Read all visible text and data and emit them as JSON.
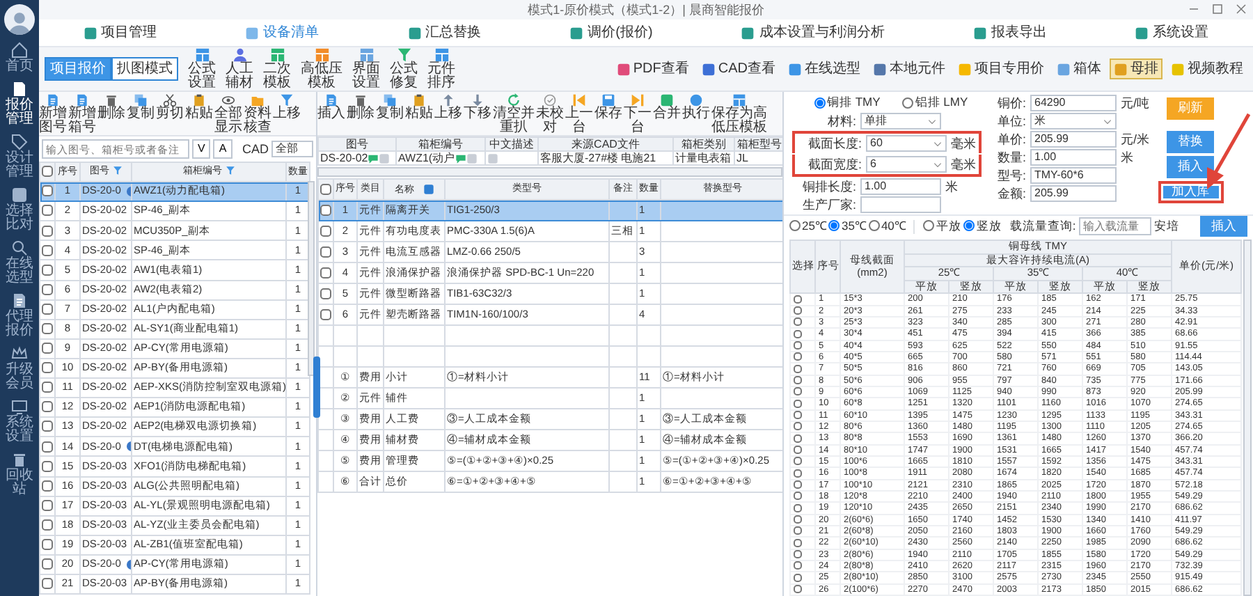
{
  "window": {
    "title": "模式1-原价模式（模式1-2）| 晨商智能报价"
  },
  "sidebar": {
    "items": [
      {
        "label": "首页",
        "selected": false
      },
      {
        "label": "报价管理",
        "selected": true
      },
      {
        "label": "设计管理",
        "selected": false
      },
      {
        "label": "选择比对",
        "selected": false
      },
      {
        "label": "在线选型",
        "selected": false
      },
      {
        "label": "代理报价",
        "selected": false
      },
      {
        "label": "升级会员",
        "selected": false
      },
      {
        "label": "系统设置",
        "selected": false
      },
      {
        "label": "回收站",
        "selected": false
      }
    ]
  },
  "menu": [
    {
      "label": "项目管理",
      "selected": false
    },
    {
      "label": "设备清单",
      "selected": true
    },
    {
      "label": "汇总替换",
      "selected": false
    },
    {
      "label": "调价(报价)",
      "selected": false
    },
    {
      "label": "成本设置与利润分析",
      "selected": false
    },
    {
      "label": "报表导出",
      "selected": false
    },
    {
      "label": "系统设置",
      "selected": false
    }
  ],
  "mode_buttons": [
    {
      "label": "项目报价",
      "selected": true
    },
    {
      "label": "扒图模式",
      "selected": false
    }
  ],
  "tools": [
    "公式设置",
    "人工辅材",
    "二次模板",
    "高低压模板",
    "界面设置",
    "公式修复",
    "元件排序"
  ],
  "right_tools": [
    {
      "label": "PDF查看",
      "selected": false
    },
    {
      "label": "CAD查看",
      "selected": false
    },
    {
      "label": "在线选型",
      "selected": false
    },
    {
      "label": "本地元件",
      "selected": false
    },
    {
      "label": "项目专用价",
      "selected": false
    },
    {
      "label": "箱体",
      "selected": false
    },
    {
      "label": "母排",
      "selected": true
    },
    {
      "label": "视频教程",
      "selected": false
    }
  ],
  "list_panel": {
    "toolbar": [
      "新增图号",
      "新增箱号",
      "删除",
      "复制",
      "剪切",
      "粘贴",
      "全部显示",
      "资料核查",
      "上移"
    ],
    "search": {
      "placeholder": "输入图号、箱柜号或者备注"
    },
    "sort_buttons": [
      "V",
      "A"
    ],
    "cad_label": "CAD",
    "cad_filter": "全部",
    "all_checked": false,
    "columns": [
      "序号",
      "图号",
      "箱柜编号",
      "数量"
    ],
    "rows": [
      {
        "no": "1",
        "drawing": "DS-20-0",
        "flag": true,
        "cabinet": "AWZ1(动力配电箱)",
        "qty": "1",
        "checked": false,
        "selected": true
      },
      {
        "no": "2",
        "drawing": "DS-20-02",
        "flag": false,
        "cabinet": "SP-46_副本",
        "qty": "1",
        "checked": false,
        "selected": false
      },
      {
        "no": "3",
        "drawing": "DS-20-02",
        "flag": false,
        "cabinet": "MCU350P_副本",
        "qty": "1",
        "checked": false,
        "selected": false
      },
      {
        "no": "4",
        "drawing": "DS-20-02",
        "flag": false,
        "cabinet": "SP-46_副本",
        "qty": "1",
        "checked": false,
        "selected": false
      },
      {
        "no": "5",
        "drawing": "DS-20-02",
        "flag": false,
        "cabinet": "AW1(电表箱1)",
        "qty": "1",
        "checked": false,
        "selected": false
      },
      {
        "no": "6",
        "drawing": "DS-20-02",
        "flag": false,
        "cabinet": "AW2(电表箱2)",
        "qty": "1",
        "checked": false,
        "selected": false
      },
      {
        "no": "7",
        "drawing": "DS-20-02",
        "flag": false,
        "cabinet": "AL1(户内配电箱)",
        "qty": "1",
        "checked": false,
        "selected": false
      },
      {
        "no": "8",
        "drawing": "DS-20-02",
        "flag": false,
        "cabinet": "AL-SY1(商业配电箱1)",
        "qty": "1",
        "checked": false,
        "selected": false
      },
      {
        "no": "9",
        "drawing": "DS-20-02",
        "flag": false,
        "cabinet": "AP-CY(常用电源箱)",
        "qty": "1",
        "checked": false,
        "selected": false
      },
      {
        "no": "10",
        "drawing": "DS-20-02",
        "flag": false,
        "cabinet": "AP-BY(备用电源箱)",
        "qty": "1",
        "checked": false,
        "selected": false
      },
      {
        "no": "11",
        "drawing": "DS-20-02",
        "flag": false,
        "cabinet": "AEP-XKS(消防控制室双电源箱)",
        "qty": "1",
        "checked": false,
        "selected": false
      },
      {
        "no": "12",
        "drawing": "DS-20-02",
        "flag": false,
        "cabinet": "AEP1(消防电源配电箱)",
        "qty": "1",
        "checked": false,
        "selected": false
      },
      {
        "no": "13",
        "drawing": "DS-20-02",
        "flag": false,
        "cabinet": "AEP2(电梯双电源切换箱)",
        "qty": "1",
        "checked": false,
        "selected": false
      },
      {
        "no": "14",
        "drawing": "DS-20-0",
        "flag": true,
        "cabinet": "DT(电梯电源配电箱)",
        "qty": "1",
        "checked": false,
        "selected": false
      },
      {
        "no": "15",
        "drawing": "DS-20-03",
        "flag": false,
        "cabinet": "XFO1(消防电梯配电箱)",
        "qty": "1",
        "checked": false,
        "selected": false
      },
      {
        "no": "16",
        "drawing": "DS-20-03",
        "flag": false,
        "cabinet": "ALG(公共照明配电箱)",
        "qty": "1",
        "checked": false,
        "selected": false
      },
      {
        "no": "17",
        "drawing": "DS-20-03",
        "flag": false,
        "cabinet": "AL-YL(景观照明电源配电箱)",
        "qty": "1",
        "checked": false,
        "selected": false
      },
      {
        "no": "18",
        "drawing": "DS-20-03",
        "flag": false,
        "cabinet": "AL-YZ(业主委员会配电箱)",
        "qty": "1",
        "checked": false,
        "selected": false
      },
      {
        "no": "19",
        "drawing": "DS-20-03",
        "flag": false,
        "cabinet": "AL-ZB1(值班室配电箱)",
        "qty": "1",
        "checked": false,
        "selected": false
      },
      {
        "no": "20",
        "drawing": "DS-20-0",
        "flag": true,
        "cabinet": "AP-CY(常用电源箱)",
        "qty": "1",
        "checked": false,
        "selected": false
      },
      {
        "no": "21",
        "drawing": "DS-20-03",
        "flag": false,
        "cabinet": "AP-BY(备用电源箱)",
        "qty": "1",
        "checked": false,
        "selected": false
      }
    ]
  },
  "detail_panel": {
    "toolbar": [
      "插入",
      "删除",
      "复制",
      "粘贴",
      "上移",
      "下移",
      "清空并重扒",
      "未校对",
      "上一台",
      "保存",
      "下一台",
      "合并",
      "执行",
      "保存为高低压模板"
    ],
    "fields": [
      {
        "label": "图号",
        "value": "DS-20-02",
        "chat_icon": true,
        "tag_icon": true
      },
      {
        "label": "箱柜编号",
        "value": "AWZ1(动户",
        "chat_icon": true,
        "tag_icon": true
      },
      {
        "label": "中文描述",
        "chat_icon": false,
        "tag_icon": true
      },
      {
        "label": "来源CAD文件",
        "value": "客服大厦-27#楼 电施21",
        "chat_icon": false,
        "tag_icon": false
      },
      {
        "label": "箱柜类别",
        "value": "计量电表箱",
        "chat_icon": false,
        "tag_icon": false
      },
      {
        "label": "箱柜型号",
        "value": "JL",
        "chat_icon": false,
        "tag_icon": false
      }
    ],
    "all_checked": false,
    "columns": [
      "序号",
      "类目",
      "名称",
      "类型号",
      "备注",
      "数量",
      "替换型号"
    ],
    "items": [
      {
        "no": "1",
        "category": "元件",
        "name": "隔离开关",
        "model": "TIG1-250/3",
        "qty": "1",
        "checked": false,
        "selected": true
      },
      {
        "no": "2",
        "category": "元件",
        "name": "有功电度表",
        "model": "PMC-330A 1.5(6)A",
        "note": "三相",
        "qty": "1",
        "checked": false,
        "selected": false
      },
      {
        "no": "3",
        "category": "元件",
        "name": "电流互感器",
        "model": "LMZ-0.66 250/5",
        "qty": "3",
        "checked": false,
        "selected": false
      },
      {
        "no": "4",
        "category": "元件",
        "name": "浪涌保护器",
        "model": "浪涌保护器 SPD-BC-1 Un=220",
        "qty": "1",
        "checked": false,
        "selected": false
      },
      {
        "no": "5",
        "category": "元件",
        "name": "微型断路器",
        "model": "TIB1-63C32/3",
        "qty": "1",
        "checked": false,
        "selected": false
      },
      {
        "no": "6",
        "category": "元件",
        "name": "塑壳断路器",
        "model": "TIM1N-160/100/3",
        "qty": "4",
        "checked": false,
        "selected": false
      }
    ],
    "summary": [
      {
        "no": "①",
        "category": "费用",
        "name": "小计",
        "model": "①=材料小计",
        "qty": "11",
        "replace": "①=材料小计"
      },
      {
        "no": "②",
        "category": "元件",
        "name": "辅件",
        "qty": "1"
      },
      {
        "no": "③",
        "category": "费用",
        "name": "人工费",
        "model": "③=人工成本金额",
        "qty": "1",
        "replace": "③=人工成本金额"
      },
      {
        "no": "④",
        "category": "费用",
        "name": "辅材费",
        "model": "④=辅材成本金额",
        "qty": "1",
        "replace": "④=辅材成本金额"
      },
      {
        "no": "⑤",
        "category": "费用",
        "name": "管理费",
        "model": "⑤=(①+②+③+④)×0.25",
        "qty": "1",
        "replace": "⑤=(①+②+③+④)×0.25"
      },
      {
        "no": "⑥",
        "category": "合计",
        "name": "总价",
        "model": "⑥=①+②+③+④+⑤",
        "qty": "1",
        "replace": "⑥=①+②+③+④+⑤"
      }
    ]
  },
  "busbar": {
    "materials": [
      {
        "label": "铜排 TMY",
        "selected": true
      },
      {
        "label": "铝排 LMY",
        "selected": false
      }
    ],
    "fields_left": [
      {
        "label": "材料:",
        "value": "单排",
        "kind": "select",
        "highlighted": false
      },
      {
        "label": "截面长度:",
        "value": "60",
        "unit": "毫米",
        "kind": "select",
        "highlighted": true
      },
      {
        "label": "截面宽度:",
        "value": "6",
        "unit": "毫米",
        "kind": "select",
        "highlighted": true
      },
      {
        "label": "铜排长度:",
        "value": "1.00",
        "unit": "米",
        "kind": "input",
        "highlighted": false
      },
      {
        "label": "生产厂家:",
        "kind": "input",
        "highlighted": false
      }
    ],
    "fields_right": [
      {
        "label": "铜价:",
        "value": "64290",
        "unit": "元/吨",
        "kind": "input"
      },
      {
        "label": "单位:",
        "value": "米",
        "kind": "select"
      },
      {
        "label": "单价:",
        "value": "205.99",
        "unit": "元/米",
        "kind": "input"
      },
      {
        "label": "数量:",
        "value": "1.00",
        "unit": "米",
        "kind": "input"
      },
      {
        "label": "型号:",
        "value": "TMY-60*6",
        "kind": "input"
      },
      {
        "label": "金额:",
        "value": "205.99",
        "kind": "input"
      }
    ],
    "buttons": [
      {
        "label": "刷新",
        "kind": "warning",
        "highlighted": false
      },
      {
        "label": "替换",
        "kind": "primary",
        "highlighted": false
      },
      {
        "label": "插入",
        "kind": "primary",
        "highlighted": false
      },
      {
        "label": "加入库",
        "kind": "primary",
        "highlighted": true
      }
    ],
    "temperatures": [
      {
        "label": "25℃",
        "selected": false
      },
      {
        "label": "35℃",
        "selected": true
      },
      {
        "label": "40℃",
        "selected": false
      }
    ],
    "placements": [
      {
        "label": "平放",
        "selected": false
      },
      {
        "label": "竖放",
        "selected": true
      }
    ],
    "query": {
      "label": "载流量查询:",
      "placeholder": "输入载流量",
      "unit": "安培",
      "button": "插入"
    },
    "table": {
      "title": "铜母线 TMY",
      "group_heading": "最大容许持续电流(A)",
      "select_heading": "选择",
      "no_heading": "序号",
      "section_heading": "母线截面(mm2)",
      "price_heading": "单价(元/米)",
      "temps": [
        "25℃",
        "35℃",
        "40℃"
      ],
      "sub_headings": [
        "平放",
        "竖放",
        "平放",
        "竖放",
        "平放",
        "竖放"
      ],
      "rows": [
        {
          "checked": false,
          "cells": [
            "1",
            "15*3",
            "200",
            "210",
            "176",
            "185",
            "162",
            "171",
            "25.75"
          ]
        },
        {
          "checked": false,
          "cells": [
            "2",
            "20*3",
            "261",
            "275",
            "233",
            "245",
            "214",
            "225",
            "34.33"
          ]
        },
        {
          "checked": false,
          "cells": [
            "3",
            "25*3",
            "323",
            "340",
            "285",
            "300",
            "271",
            "280",
            "42.91"
          ]
        },
        {
          "checked": false,
          "cells": [
            "4",
            "30*4",
            "451",
            "475",
            "394",
            "415",
            "366",
            "385",
            "68.66"
          ]
        },
        {
          "checked": false,
          "cells": [
            "5",
            "40*4",
            "593",
            "625",
            "522",
            "550",
            "484",
            "510",
            "91.55"
          ]
        },
        {
          "checked": false,
          "cells": [
            "6",
            "40*5",
            "665",
            "700",
            "580",
            "571",
            "551",
            "580",
            "114.44"
          ]
        },
        {
          "checked": false,
          "cells": [
            "7",
            "50*5",
            "816",
            "860",
            "721",
            "760",
            "669",
            "705",
            "143.05"
          ]
        },
        {
          "checked": false,
          "cells": [
            "8",
            "50*6",
            "906",
            "955",
            "797",
            "840",
            "735",
            "775",
            "171.66"
          ]
        },
        {
          "checked": false,
          "cells": [
            "9",
            "60*6",
            "1069",
            "1125",
            "940",
            "990",
            "873",
            "920",
            "205.99"
          ]
        },
        {
          "checked": false,
          "cells": [
            "10",
            "60*8",
            "1251",
            "1320",
            "1101",
            "1160",
            "1016",
            "1070",
            "274.65"
          ]
        },
        {
          "checked": false,
          "cells": [
            "11",
            "60*10",
            "1395",
            "1475",
            "1230",
            "1295",
            "1133",
            "1195",
            "343.31"
          ]
        },
        {
          "checked": false,
          "cells": [
            "12",
            "80*6",
            "1360",
            "1480",
            "1195",
            "1300",
            "1110",
            "1205",
            "274.65"
          ]
        },
        {
          "checked": false,
          "cells": [
            "13",
            "80*8",
            "1553",
            "1690",
            "1361",
            "1480",
            "1260",
            "1370",
            "366.20"
          ]
        },
        {
          "checked": false,
          "cells": [
            "14",
            "80*10",
            "1747",
            "1900",
            "1531",
            "1665",
            "1417",
            "1540",
            "457.74"
          ]
        },
        {
          "checked": false,
          "cells": [
            "15",
            "100*6",
            "1665",
            "1810",
            "1557",
            "1592",
            "1356",
            "1475",
            "343.31"
          ]
        },
        {
          "checked": false,
          "cells": [
            "16",
            "100*8",
            "1911",
            "2080",
            "1674",
            "1820",
            "1540",
            "1685",
            "457.74"
          ]
        },
        {
          "checked": false,
          "cells": [
            "17",
            "100*10",
            "2121",
            "2310",
            "1865",
            "2025",
            "1720",
            "1870",
            "572.18"
          ]
        },
        {
          "checked": false,
          "cells": [
            "18",
            "120*8",
            "2210",
            "2400",
            "1940",
            "2110",
            "1800",
            "1955",
            "549.29"
          ]
        },
        {
          "checked": false,
          "cells": [
            "19",
            "120*10",
            "2435",
            "2650",
            "2151",
            "2340",
            "1990",
            "2170",
            "686.62"
          ]
        },
        {
          "checked": false,
          "cells": [
            "20",
            "2(60*6)",
            "1650",
            "1740",
            "1452",
            "1530",
            "1340",
            "1410",
            "411.97"
          ]
        },
        {
          "checked": false,
          "cells": [
            "21",
            "2(60*8)",
            "2050",
            "2160",
            "1803",
            "1900",
            "1660",
            "1760",
            "549.29"
          ]
        },
        {
          "checked": false,
          "cells": [
            "22",
            "2(60*10)",
            "2430",
            "2560",
            "2140",
            "2250",
            "1985",
            "2090",
            "686.62"
          ]
        },
        {
          "checked": false,
          "cells": [
            "23",
            "2(80*6)",
            "1940",
            "2110",
            "1705",
            "1855",
            "1580",
            "1720",
            "549.29"
          ]
        },
        {
          "checked": false,
          "cells": [
            "24",
            "2(80*8)",
            "2410",
            "2620",
            "2117",
            "2315",
            "1960",
            "2170",
            "732.39"
          ]
        },
        {
          "checked": false,
          "cells": [
            "25",
            "2(80*10)",
            "2850",
            "3100",
            "2575",
            "2730",
            "2345",
            "2550",
            "915.49"
          ]
        },
        {
          "checked": false,
          "cells": [
            "26",
            "2(100*6)",
            "2270",
            "2470",
            "2003",
            "2173",
            "1850",
            "2015",
            "686.62"
          ]
        }
      ]
    }
  }
}
